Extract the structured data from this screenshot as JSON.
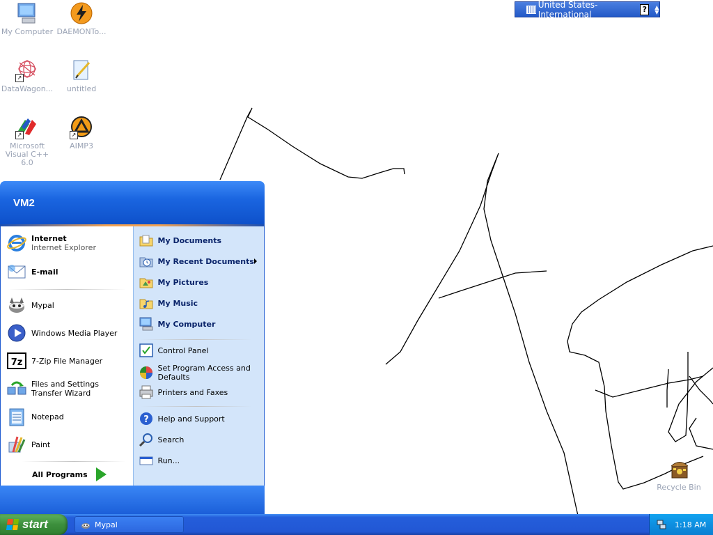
{
  "desktop": {
    "icons": [
      {
        "label": "My Computer",
        "icon": "my-computer-icon"
      },
      {
        "label": "DAEMONTo...",
        "icon": "daemon-tools-icon"
      },
      {
        "label": "DataWagon...",
        "icon": "datawagon-icon"
      },
      {
        "label": "untitled",
        "icon": "paint-document-icon"
      },
      {
        "label": "Microsoft Visual C++ 6.0",
        "icon": "visual-cpp-icon"
      },
      {
        "label": "AIMP3",
        "icon": "aimp3-icon"
      },
      {
        "label": "Recycle Bin",
        "icon": "recycle-bin-icon"
      }
    ]
  },
  "langbar": {
    "label": "United States-International",
    "help": "?"
  },
  "start_menu": {
    "user_name": "VM2",
    "pinned": [
      {
        "title": "Internet",
        "subtitle": "Internet Explorer",
        "icon": "internet-explorer-icon"
      },
      {
        "title": "E-mail",
        "icon": "email-icon"
      }
    ],
    "recent": [
      {
        "title": "Mypal",
        "icon": "mypal-icon"
      },
      {
        "title": "Windows Media Player",
        "icon": "media-player-icon"
      },
      {
        "title": "7-Zip File Manager",
        "icon": "7zip-icon"
      },
      {
        "title": "Files and Settings Transfer Wizard",
        "icon": "transfer-wizard-icon"
      },
      {
        "title": "Notepad",
        "icon": "notepad-icon"
      },
      {
        "title": "Paint",
        "icon": "paint-icon"
      }
    ],
    "all_programs": "All Programs",
    "places": [
      {
        "title": "My Documents",
        "icon": "my-documents-icon"
      },
      {
        "title": "My Recent Documents",
        "icon": "my-recent-documents-icon"
      },
      {
        "title": "My Pictures",
        "icon": "my-pictures-icon"
      },
      {
        "title": "My Music",
        "icon": "my-music-icon"
      },
      {
        "title": "My Computer",
        "icon": "my-computer-icon"
      }
    ],
    "settings": [
      {
        "title": "Control Panel",
        "icon": "control-panel-icon"
      },
      {
        "title": "Set Program Access and Defaults",
        "icon": "program-access-icon"
      },
      {
        "title": "Printers and Faxes",
        "icon": "printer-icon"
      }
    ],
    "help": [
      {
        "title": "Help and Support",
        "icon": "help-icon"
      },
      {
        "title": "Search",
        "icon": "search-icon"
      },
      {
        "title": "Run...",
        "icon": "run-icon"
      }
    ]
  },
  "taskbar": {
    "start_label": "start",
    "task": {
      "label": "Mypal",
      "icon": "mypal-icon"
    },
    "clock": "1:18 AM"
  },
  "colors": {
    "taskbar": "#245edb",
    "start_button": "#3c8f3c",
    "tray": "#0e8fe0",
    "places_bg": "#d3e5fa"
  }
}
